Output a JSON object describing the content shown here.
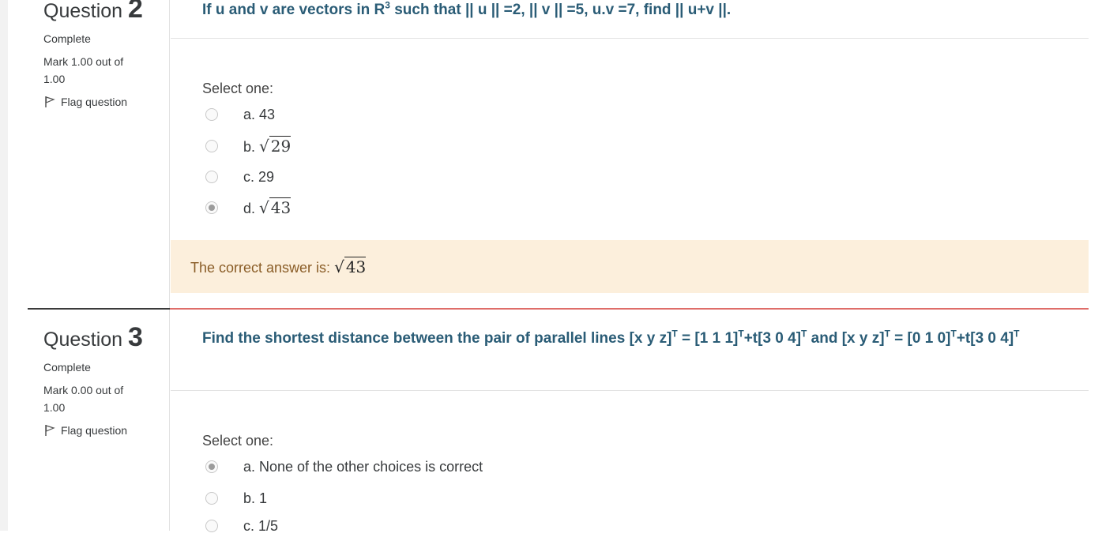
{
  "q2": {
    "label": "Question",
    "number": "2",
    "state": "Complete",
    "grade": "Mark 1.00 out of 1.00",
    "flag": "Flag question",
    "text_a": "If u and v are vectors in R",
    "text_sup": "3",
    "text_b": " such that || u || =2, || v || =5, u.v =7, find || u+v ||.",
    "prompt": "Select one:",
    "options": [
      {
        "prefix": "a. 43",
        "radicand": "",
        "checked": false
      },
      {
        "prefix": "b. ",
        "radicand": "29",
        "checked": false
      },
      {
        "prefix": "c. 29",
        "radicand": "",
        "checked": false
      },
      {
        "prefix": "d. ",
        "radicand": "43",
        "checked": true
      }
    ],
    "feedback_prefix": "The correct answer is: ",
    "feedback_radicand": "43"
  },
  "q3": {
    "label": "Question",
    "number": "3",
    "state": "Complete",
    "grade": "Mark 0.00 out of 1.00",
    "flag": "Flag question",
    "text_1": "Find the shortest distance between the pair of parallel lines [x  y  z]",
    "sup_T": "T",
    "text_2": " = [1  1  1]",
    "text_3": "+t[3  0  4]",
    "text_4": " and  [x  y  z]",
    "text_5": " = [0  1  0]",
    "text_6": "+t[3  0  4]",
    "prompt": "Select one:",
    "options": [
      {
        "label": "a. None of the other choices is correct",
        "checked": true
      },
      {
        "label": "b. 1",
        "checked": false
      },
      {
        "label": "c. 1/5",
        "checked": false
      }
    ]
  }
}
